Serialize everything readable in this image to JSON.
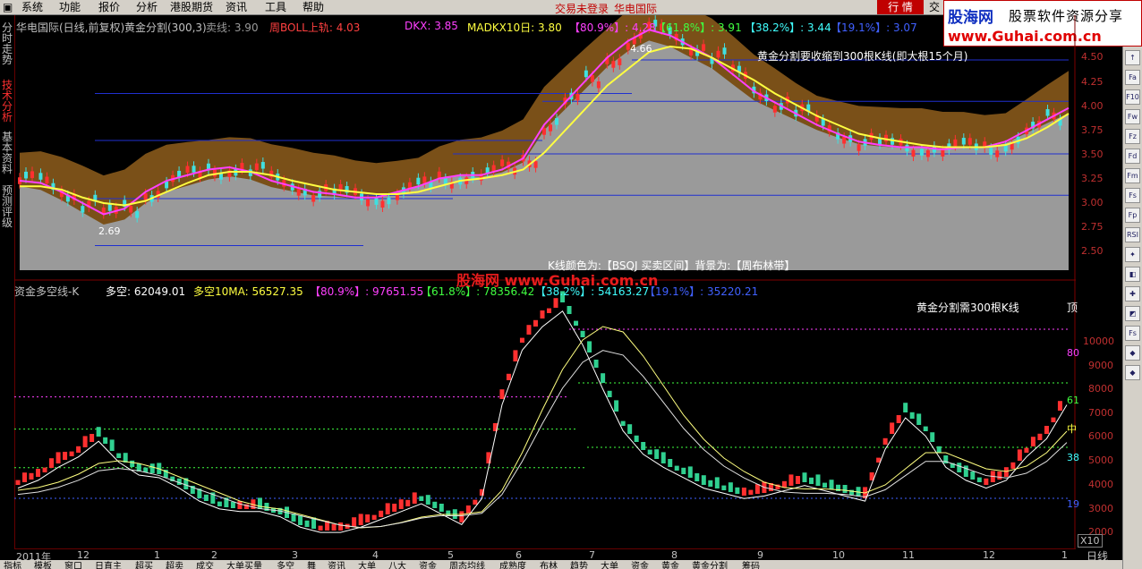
{
  "menu": {
    "items": [
      "系统",
      "功能",
      "报价",
      "分析",
      "港股期货",
      "资讯",
      "工具",
      "帮助"
    ],
    "status": "交易未登录",
    "broker": "华电国际",
    "active_tab": "行  情",
    "tab_stub": "交"
  },
  "logo": {
    "brand": "股海网",
    "slogan": "股票软件资源分享",
    "url": "www.Guhai.com.cn"
  },
  "left_tabs": [
    {
      "label": "分时走势",
      "active": false
    },
    {
      "label": "技术分析",
      "active": true
    },
    {
      "label": "基本资料",
      "active": false
    },
    {
      "label": "预测评级",
      "active": false
    }
  ],
  "upper": {
    "title": "华电国际(日线,前复权)",
    "indicator": "黄金分割(300,3)",
    "sell_label": "卖线: 3.90",
    "boll_label": "周BOLL上轨: 4.03",
    "dkx_label": "DKX: 3.85",
    "madkx_label": "MADKX10日: 3.80",
    "fib_labels": [
      "【80.9%】: 4.28",
      "【61.8%】: 3.91",
      "【38.2%】: 3.44",
      "【19.1%】: 3.07"
    ],
    "note_top": "黄金分割要收缩到300根K线(即大根15个月)",
    "note_bottom": "K线颜色为:【BSQJ 买卖区间】背景为:【周布林带】",
    "high_label": "4.66",
    "low_label": "2.69",
    "axis_labels": [
      "4.50",
      "4.25",
      "4.00",
      "3.75",
      "3.50",
      "3.25",
      "3.00",
      "2.75",
      "2.50"
    ]
  },
  "lower": {
    "title": "资金多空线-K",
    "dk_label": "多空: 62049.01",
    "dk10_label": "多空10MA: 56527.35",
    "fib_labels": [
      "【80.9%】: 97651.55",
      "【61.8%】: 78356.42",
      "【38.2%】: 54163.27",
      "【19.1%】: 35220.21"
    ],
    "note": "黄金分割需300根K线",
    "top_label": "顶",
    "level_marks": [
      "80",
      "61",
      "中",
      "38",
      "19"
    ],
    "axis_labels": [
      "10000",
      "9000",
      "8000",
      "7000",
      "6000",
      "5000",
      "4000",
      "3000",
      "2000"
    ]
  },
  "watermark": "股海网  www.Guhai.com.cn",
  "date_axis": [
    "2011年",
    "12",
    "1",
    "2",
    "3",
    "4",
    "5",
    "6",
    "7",
    "8",
    "9",
    "10",
    "11",
    "12",
    "1"
  ],
  "zoom": "X10",
  "period": "日线",
  "period_short": "周",
  "bottom_tabs": [
    "指标",
    "模板",
    "窗口",
    "日直主",
    "超买",
    "超卖",
    "成交",
    "大单买量",
    "多空",
    "舞",
    "资讯",
    "大单",
    "八大",
    "资金",
    "周态均线",
    "成熟度",
    "布林",
    "趋势",
    "大单",
    "资金",
    "黄金",
    "黄金分割",
    "筹码"
  ],
  "right_toolbar": [
    "↑",
    "Fa",
    "F10",
    "Fw",
    "Fz",
    "Fd",
    "Fm",
    "Fs",
    "Fp",
    "RSI",
    "✦",
    "◧",
    "✚",
    "◩",
    "Fs",
    "◆",
    "◆"
  ],
  "colors": {
    "up": "#ff3030",
    "down": "#40e0e0",
    "volume_up": "#ff3030",
    "volume_down": "#30d090",
    "yellow": "#ffff40",
    "magenta": "#ff40ff",
    "brown": "#7a5018",
    "gray": "#9a9a9a",
    "blue": "#2030d0",
    "accent": "#c00000"
  },
  "chart_data": [
    {
      "type": "line",
      "title": "华电国际(日线,前复权)",
      "ylim": [
        2.4,
        4.6
      ],
      "series": [
        {
          "name": "DKX",
          "values": [
            3.2,
            3.18,
            3.1,
            3.0,
            2.9,
            2.95,
            3.1,
            3.2,
            3.25,
            3.3,
            3.32,
            3.28,
            3.2,
            3.15,
            3.1,
            3.08,
            3.05,
            3.05,
            3.1,
            3.15,
            3.22,
            3.25,
            3.25,
            3.3,
            3.4,
            3.7,
            3.9,
            4.1,
            4.3,
            4.45,
            4.55,
            4.5,
            4.4,
            4.3,
            4.15,
            4.0,
            3.9,
            3.8,
            3.7,
            3.62,
            3.55,
            3.52,
            3.5,
            3.5,
            3.48,
            3.5,
            3.5,
            3.55,
            3.65,
            3.75,
            3.85
          ]
        },
        {
          "name": "MADKX10日",
          "values": [
            3.15,
            3.15,
            3.12,
            3.05,
            3.0,
            2.98,
            3.02,
            3.1,
            3.18,
            3.25,
            3.28,
            3.28,
            3.25,
            3.2,
            3.16,
            3.12,
            3.1,
            3.08,
            3.08,
            3.1,
            3.15,
            3.2,
            3.22,
            3.25,
            3.3,
            3.45,
            3.65,
            3.85,
            4.05,
            4.2,
            4.35,
            4.4,
            4.38,
            4.3,
            4.2,
            4.1,
            3.98,
            3.88,
            3.78,
            3.7,
            3.62,
            3.58,
            3.55,
            3.52,
            3.5,
            3.5,
            3.5,
            3.52,
            3.58,
            3.68,
            3.8
          ]
        }
      ]
    },
    {
      "type": "line",
      "title": "资金多空线-K",
      "ylim": [
        1700,
        10900
      ],
      "series": [
        {
          "name": "多空",
          "values": [
            4000,
            4300,
            4800,
            5200,
            5800,
            5000,
            4500,
            4400,
            4000,
            3500,
            3200,
            3100,
            3100,
            2900,
            2500,
            2300,
            2300,
            2500,
            2800,
            3100,
            3400,
            3000,
            2600,
            3600,
            7200,
            9300,
            10200,
            10800,
            9500,
            7800,
            6200,
            5300,
            4800,
            4400,
            4000,
            3800,
            3600,
            3700,
            3900,
            4100,
            3900,
            3700,
            3500,
            5500,
            6700,
            6000,
            4800,
            4300,
            4000,
            4300,
            5200,
            5900,
            7200
          ]
        },
        {
          "name": "多空10MA",
          "values": [
            3800,
            3900,
            4100,
            4400,
            4800,
            4900,
            4800,
            4600,
            4300,
            4000,
            3700,
            3400,
            3200,
            3100,
            2900,
            2700,
            2500,
            2400,
            2450,
            2600,
            2800,
            2900,
            2900,
            3000,
            3800,
            5200,
            6800,
            8300,
            9400,
            9900,
            9700,
            8800,
            7700,
            6600,
            5700,
            5000,
            4500,
            4100,
            3900,
            3850,
            3850,
            3800,
            3700,
            4000,
            4600,
            5200,
            5200,
            4900,
            4600,
            4500,
            4700,
            5200,
            6000
          ]
        }
      ]
    }
  ]
}
